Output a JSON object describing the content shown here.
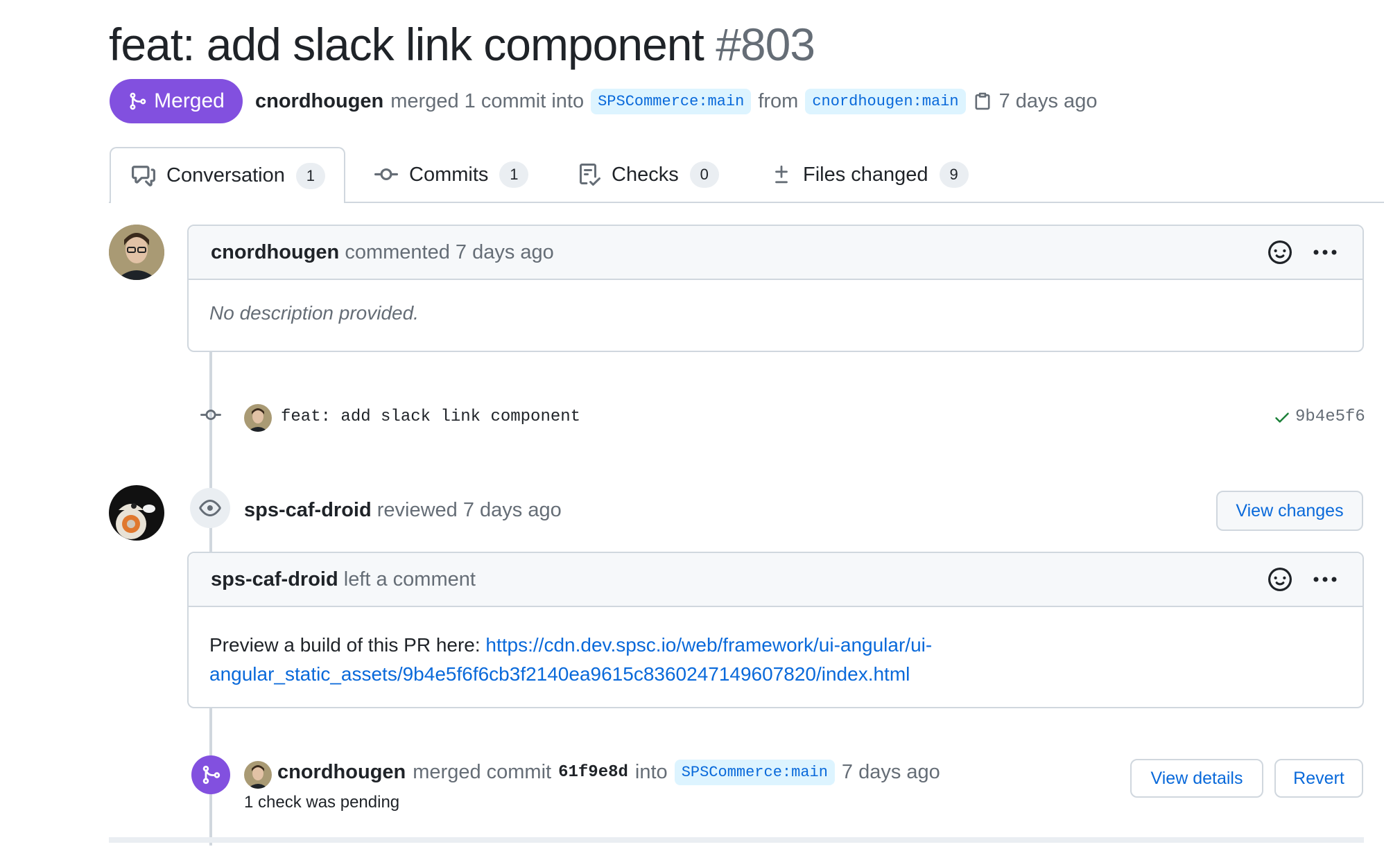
{
  "pr": {
    "title": "feat: add slack link component",
    "number": "#803",
    "state": "Merged",
    "author": "cnordhougen",
    "merge_text": "merged 1 commit into",
    "base_branch": "SPSCommerce:main",
    "from_text": "from",
    "head_branch": "cnordhougen:main",
    "time": "7 days ago",
    "colors": {
      "merged": "#8250df",
      "link": "#0969da",
      "border": "#d0d7de"
    }
  },
  "tabs": [
    {
      "label": "Conversation",
      "count": "1",
      "icon": "comment-discussion-icon"
    },
    {
      "label": "Commits",
      "count": "1",
      "icon": "git-commit-icon"
    },
    {
      "label": "Checks",
      "count": "0",
      "icon": "checklist-icon"
    },
    {
      "label": "Files changed",
      "count": "9",
      "icon": "diff-icon"
    }
  ],
  "timeline": {
    "first_comment": {
      "author": "cnordhougen",
      "action": "commented 7 days ago",
      "body": "No description provided."
    },
    "commit": {
      "message": "feat: add slack link component",
      "sha": "9b4e5f6"
    },
    "review": {
      "author": "sps-caf-droid",
      "action": "reviewed 7 days ago",
      "view_changes_label": "View changes"
    },
    "review_comment": {
      "author": "sps-caf-droid",
      "action": "left a comment",
      "body_prefix": "Preview a build of this PR here:",
      "link_line1": "https://cdn.dev.spsc.io/web/framework/ui-angular/ui-",
      "link_line2": "angular_static_assets/9b4e5f6f6cb3f2140ea9615c8360247149607820/index.html"
    },
    "merge_event": {
      "author": "cnordhougen",
      "action": "merged commit",
      "sha": "61f9e8d",
      "into_text": "into",
      "branch": "SPSCommerce:main",
      "time": "7 days ago",
      "checks_text": "1 check was pending",
      "view_details_label": "View details",
      "revert_label": "Revert"
    }
  }
}
